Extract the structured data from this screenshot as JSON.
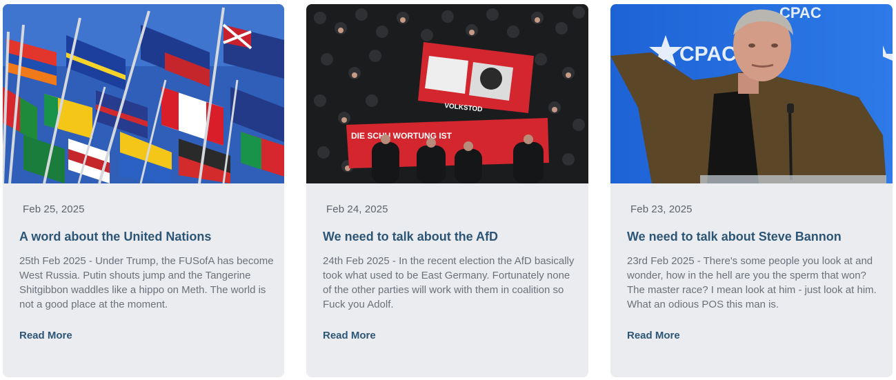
{
  "posts": [
    {
      "date": "Feb 25, 2025",
      "title": "A word about the United Nations",
      "excerpt": "25th Feb 2025 - Under Trump, the FUSofA has become West Russia. Putin shouts jump and the Tangerine Shitgibbon waddles like a hippo on Meth. The world is not a good place at the moment.",
      "read_more": "Read More"
    },
    {
      "date": "Feb 24, 2025",
      "title": "We need to talk about the AfD",
      "excerpt": "24th Feb 2025 - In the recent election the AfD basically took what used to be East Germany. Fortunately none of the other parties will work with them in coalition so Fuck you Adolf.",
      "read_more": "Read More"
    },
    {
      "date": "Feb 23, 2025",
      "title": "We need to talk about Steve Bannon",
      "excerpt": "23rd Feb 2025 - There's some people you look at and wonder, how in the hell are you the sperm that won? The master race? I mean look at him - just look at him. What an odious POS this man is.",
      "read_more": "Read More"
    }
  ],
  "images": [
    {
      "icon": "flags-photo"
    },
    {
      "icon": "protest-photo",
      "banner_text_1": "VOLKSTOD",
      "banner_text_2": "DIE SCHU  WORTUNG IST"
    },
    {
      "icon": "speaker-photo",
      "backdrop_text": "CPAC"
    }
  ],
  "colors": {
    "card_bg": "#ebecf0",
    "title": "#2c5576",
    "date": "#5c636b",
    "excerpt": "#6b7178"
  }
}
